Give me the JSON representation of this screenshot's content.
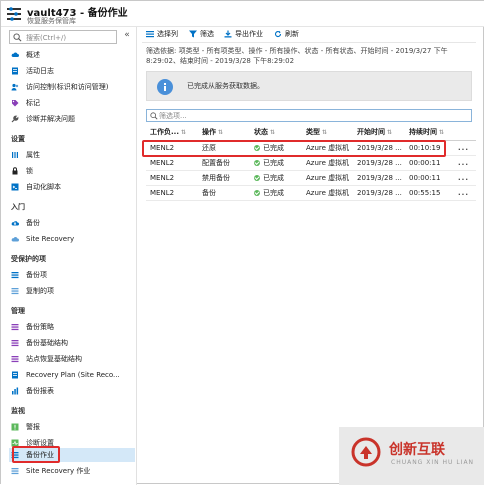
{
  "header": {
    "title": "vault473 - 备份作业",
    "subtitle": "恢复服务保管库"
  },
  "sidebar": {
    "search_placeholder": "搜索(Ctrl+/)",
    "collapse_glyph": "«",
    "items_top": [
      {
        "label": "概述",
        "icon": "cloud-icon"
      },
      {
        "label": "活动日志",
        "icon": "log-icon"
      },
      {
        "label": "访问控制(标识和访问管理)",
        "icon": "people-icon"
      },
      {
        "label": "标记",
        "icon": "tag-icon"
      },
      {
        "label": "诊断并解决问题",
        "icon": "wrench-icon"
      }
    ],
    "section_settings": "设置",
    "items_settings": [
      {
        "label": "属性",
        "icon": "properties-icon"
      },
      {
        "label": "锁",
        "icon": "lock-icon"
      },
      {
        "label": "自动化脚本",
        "icon": "script-icon"
      }
    ],
    "section_getting_started": "入门",
    "items_getting_started": [
      {
        "label": "备份",
        "icon": "backup-icon"
      },
      {
        "label": "Site Recovery",
        "icon": "site-recovery-icon"
      }
    ],
    "section_protected": "受保护的项",
    "items_protected": [
      {
        "label": "备份项",
        "icon": "backup-items-icon"
      },
      {
        "label": "复制的项",
        "icon": "replicated-items-icon"
      }
    ],
    "section_manage": "管理",
    "items_manage": [
      {
        "label": "备份策略",
        "icon": "policy-icon"
      },
      {
        "label": "备份基础结构",
        "icon": "infrastructure-icon"
      },
      {
        "label": "站点恢复基础结构",
        "icon": "site-infra-icon"
      },
      {
        "label": "Recovery Plan (Site Reco...",
        "icon": "recovery-plan-icon"
      },
      {
        "label": "备份报表",
        "icon": "report-icon"
      }
    ],
    "section_monitoring": "监视",
    "items_monitoring": [
      {
        "label": "警报",
        "icon": "alert-icon"
      },
      {
        "label": "诊断设置",
        "icon": "diagnostic-icon"
      },
      {
        "label": "备份作业",
        "icon": "jobs-icon"
      },
      {
        "label": "Site Recovery 作业",
        "icon": "sr-jobs-icon"
      }
    ]
  },
  "toolbar": {
    "choose_columns": "选择列",
    "filter": "筛选",
    "export": "导出作业",
    "refresh": "刷新"
  },
  "filter_text": "筛选依据: 项类型 - 所有项类型、操作 - 所有操作、状态 - 所有状态、开始时间 - 2019/3/27 下午8:29:02、结束时间 - 2019/3/28 下午8:29:02",
  "info_message": "已完成从服务获取数据。",
  "table_filter_placeholder": "筛选项...",
  "table": {
    "headers": [
      "工作负...",
      "操作",
      "状态",
      "类型",
      "开始时间",
      "持续时间"
    ],
    "rows": [
      {
        "workload": "MENL2",
        "operation": "还原",
        "status": "已完成",
        "type": "Azure 虚拟机",
        "start": "2019/3/28 ...",
        "duration": "00:10:19",
        "more": "..."
      },
      {
        "workload": "MENL2",
        "operation": "配置备份",
        "status": "已完成",
        "type": "Azure 虚拟机",
        "start": "2019/3/28 ...",
        "duration": "00:00:11",
        "more": "..."
      },
      {
        "workload": "MENL2",
        "operation": "禁用备份",
        "status": "已完成",
        "type": "Azure 虚拟机",
        "start": "2019/3/28 ...",
        "duration": "00:00:11",
        "more": "..."
      },
      {
        "workload": "MENL2",
        "operation": "备份",
        "status": "已完成",
        "type": "Azure 虚拟机",
        "start": "2019/3/28 ...",
        "duration": "00:55:15",
        "more": "..."
      }
    ]
  },
  "watermark": {
    "text": "创新互联",
    "sub": "CHUANG XIN HU LIAN"
  },
  "colors": {
    "status_ok": "#5cb85c",
    "highlight": "#e02b2b",
    "active_nav": "#d4e8f8",
    "azure_blue": "#0072c6"
  }
}
